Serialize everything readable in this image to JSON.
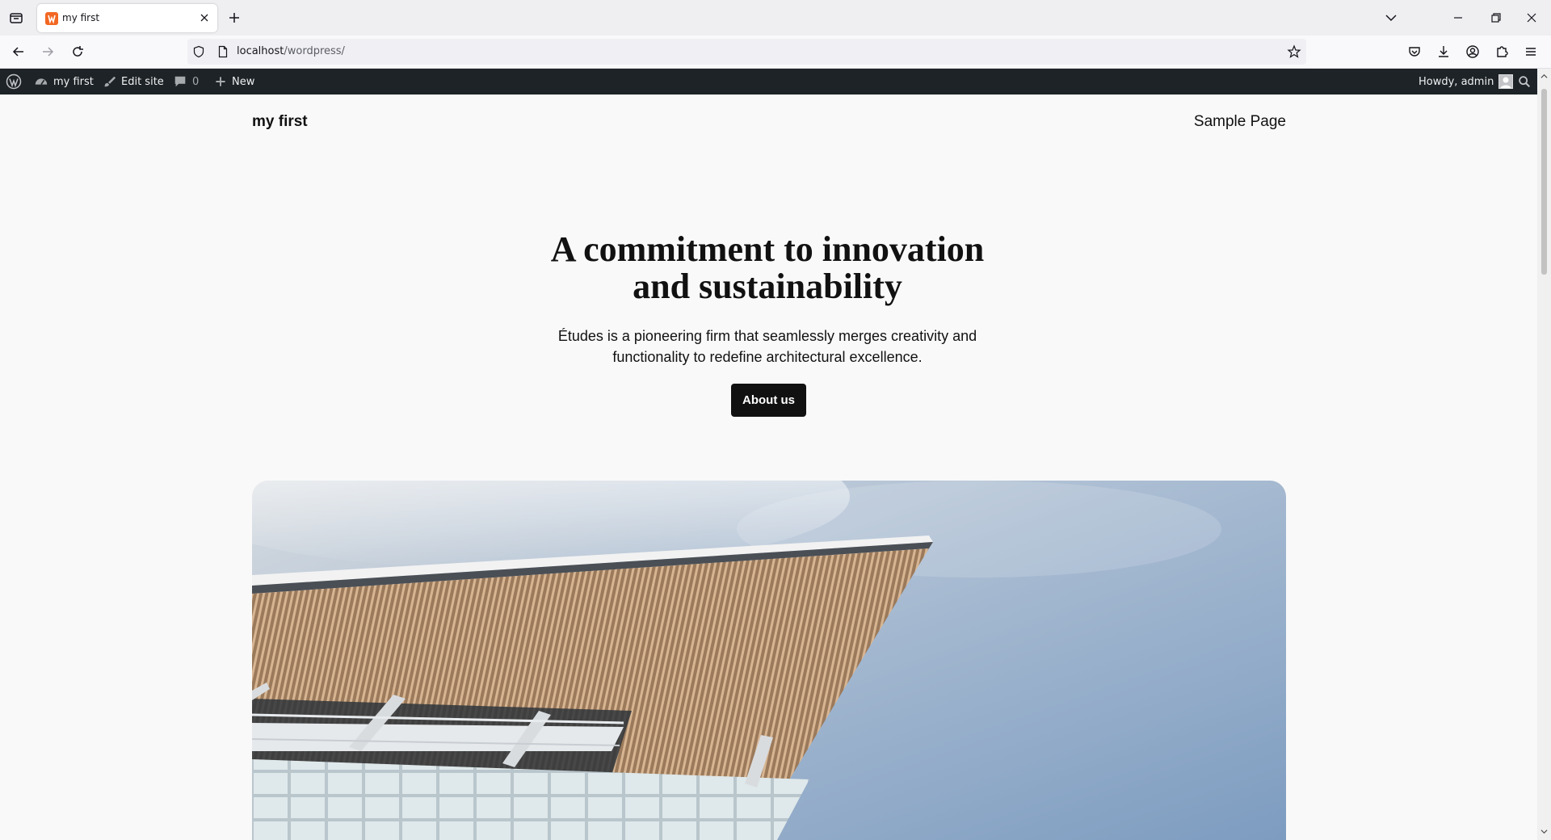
{
  "browser": {
    "tab_title": "my first",
    "url_host": "localhost",
    "url_path": "/wordpress/"
  },
  "adminbar": {
    "site_name": "my first",
    "edit_site": "Edit site",
    "comments_count": "0",
    "new_label": "New",
    "howdy": "Howdy, admin"
  },
  "site": {
    "title": "my first",
    "nav": [
      "Sample Page"
    ]
  },
  "hero": {
    "title_line1": "A commitment to innovation",
    "title_line2": "and sustainability",
    "subtitle_line1": "Études is a pioneering firm that seamlessly merges creativity and",
    "subtitle_line2": "functionality to redefine architectural excellence.",
    "button_label": "About us"
  },
  "colors": {
    "adminbar_bg": "#1d2327",
    "page_bg": "#f9f9f9",
    "button_bg": "#111111",
    "sky": "#8aa6c6"
  },
  "icons": [
    "firefox-view-icon",
    "tab-favicon",
    "close-icon",
    "plus-icon",
    "chevron-down-icon",
    "minimize-icon",
    "restore-icon",
    "window-close-icon",
    "back-icon",
    "forward-icon",
    "reload-icon",
    "shield-icon",
    "page-icon",
    "star-icon",
    "pocket-icon",
    "download-icon",
    "account-icon",
    "extensions-icon",
    "menu-icon",
    "wordpress-logo-icon",
    "dashboard-icon",
    "brush-icon",
    "comment-icon",
    "search-icon"
  ]
}
